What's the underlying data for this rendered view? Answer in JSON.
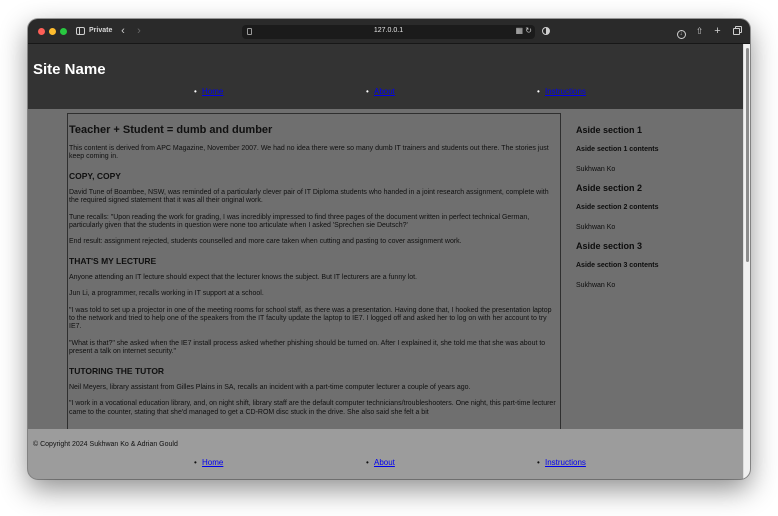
{
  "browser": {
    "private_label": "Private",
    "url": "127.0.0.1",
    "icons": {
      "back": "chevron-left-icon",
      "forward": "chevron-right-icon",
      "sidebar": "sidebar-icon",
      "reload": "reload-icon",
      "download": "download-icon",
      "share": "share-icon",
      "new_tab": "plus-icon",
      "tabs": "tabs-overview-icon"
    }
  },
  "site": {
    "name": "Site Name",
    "nav": [
      {
        "label": "Home"
      },
      {
        "label": "About"
      },
      {
        "label": "Instructions"
      }
    ]
  },
  "article": {
    "title": "Teacher + Student = dumb and dumber",
    "intro": "This content is derived from APC Magazine, November 2007. We had no idea there were so many dumb IT trainers and students out there. The stories just keep coming in.",
    "sections": [
      {
        "heading": "COPY, COPY",
        "paragraphs": [
          "David Tune of Boambee, NSW, was reminded of a particularly clever pair of IT Diploma students who handed in a joint research assignment, complete with the required signed statement that it was all their original work.",
          "Tune recalls: \"Upon reading the work for grading, I was incredibly impressed to find three pages of the document written in perfect technical German, particularly given that the students in question were none too articulate when I asked 'Sprechen sie Deutsch?'",
          "End result: assignment rejected, students counselled and more care taken when cutting and pasting to cover assignment work."
        ]
      },
      {
        "heading": "THAT'S MY LECTURE",
        "paragraphs": [
          "Anyone attending an IT lecture should expect that the lecturer knows the subject. But IT lecturers are a funny lot.",
          "Jun Li, a programmer, recalls working in IT support at a school.",
          "\"I was told to set up a projector in one of the meeting rooms for school staff, as there was a presentation. Having done that, I hooked the presentation laptop to the network and tried to help one of the speakers from the IT faculty update the laptop to IE7. I logged off and asked her to log on with her account to try IE7.",
          "\"What is that?\" she asked when the IE7 install process asked whether phishing should be turned on. After I explained it, she told me that she was about to present a talk on internet security.\""
        ]
      },
      {
        "heading": "TUTORING THE TUTOR",
        "paragraphs": [
          "Neil Meyers, library assistant from Gilles Plains in SA, recalls an incident with a part-time computer lecturer a couple of years ago.",
          "\"I work in a vocational education library, and, on night shift, library staff are the default computer technicians/troubleshooters. One night, this part-time lecturer came to the counter, stating that she'd managed to get a CD-ROM disc stuck in the drive. She also said she felt a bit"
        ]
      }
    ]
  },
  "aside": [
    {
      "title": "Aside section 1",
      "contents": "Aside section 1 contents",
      "author": "Sukhwan Ko"
    },
    {
      "title": "Aside section 2",
      "contents": "Aside section 2 contents",
      "author": "Sukhwan Ko"
    },
    {
      "title": "Aside section 3",
      "contents": "Aside section 3 contents",
      "author": "Sukhwan Ko"
    }
  ],
  "footer": {
    "copyright": "© Copyright 2024 Sukhwan Ko & Adrian Gould",
    "nav": [
      {
        "label": "Home"
      },
      {
        "label": "About"
      },
      {
        "label": "Instructions"
      }
    ]
  }
}
